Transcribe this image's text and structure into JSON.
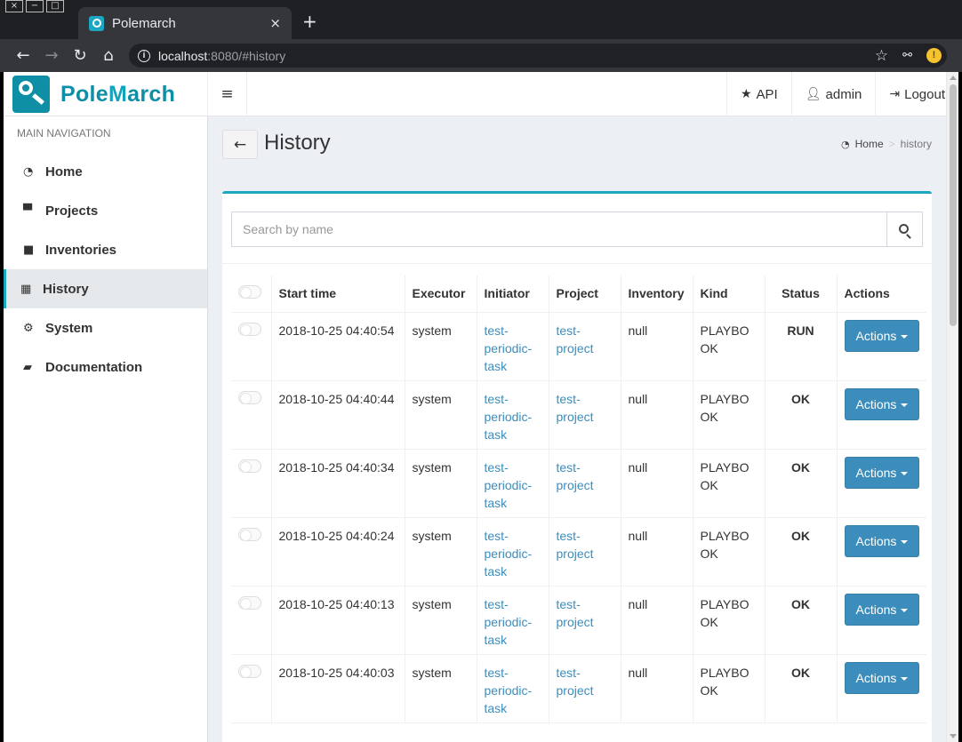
{
  "browser": {
    "tab_title": "Polemarch",
    "tab_close": "×",
    "new_tab": "+",
    "url_host": "localhost",
    "url_rest": ":8080/#history",
    "info_glyph": "i",
    "alert_glyph": "!"
  },
  "window_controls": [
    "×",
    "−",
    "□"
  ],
  "app": {
    "logo_part1": "Pole",
    "logo_part2": "M",
    "logo_part3": "arch",
    "menu_toggle": "≡",
    "top_links": {
      "api": "API",
      "user": "admin",
      "logout": "Logout"
    }
  },
  "sidebar": {
    "header": "MAIN NAVIGATION",
    "items": [
      {
        "label": "Home",
        "icon": "dashboard-icon",
        "glyph": "◔"
      },
      {
        "label": "Projects",
        "icon": "projects-icon",
        "glyph": "▀"
      },
      {
        "label": "Inventories",
        "icon": "folder-icon",
        "glyph": "■"
      },
      {
        "label": "History",
        "icon": "calendar-icon",
        "glyph": "▦",
        "active": true
      },
      {
        "label": "System",
        "icon": "gear-icon",
        "glyph": "⚙"
      },
      {
        "label": "Documentation",
        "icon": "book-icon",
        "glyph": "▰"
      }
    ]
  },
  "page": {
    "back_glyph": "🡐",
    "title": "History",
    "breadcrumb": {
      "home": "Home",
      "sep": ">",
      "current": "history"
    }
  },
  "search": {
    "placeholder": "Search by name"
  },
  "table": {
    "headers": [
      "Start time",
      "Executor",
      "Initiator",
      "Project",
      "Inventory",
      "Kind",
      "Status",
      "Actions"
    ],
    "action_label": "Actions",
    "rows": [
      {
        "start": "2018-10-25 04:40:54",
        "executor": "system",
        "initiator": "test-periodic-task",
        "project": "test-project",
        "inventory": "null",
        "kind": "PLAYBOOK",
        "status": "RUN"
      },
      {
        "start": "2018-10-25 04:40:44",
        "executor": "system",
        "initiator": "test-periodic-task",
        "project": "test-project",
        "inventory": "null",
        "kind": "PLAYBOOK",
        "status": "OK"
      },
      {
        "start": "2018-10-25 04:40:34",
        "executor": "system",
        "initiator": "test-periodic-task",
        "project": "test-project",
        "inventory": "null",
        "kind": "PLAYBOOK",
        "status": "OK"
      },
      {
        "start": "2018-10-25 04:40:24",
        "executor": "system",
        "initiator": "test-periodic-task",
        "project": "test-project",
        "inventory": "null",
        "kind": "PLAYBOOK",
        "status": "OK"
      },
      {
        "start": "2018-10-25 04:40:13",
        "executor": "system",
        "initiator": "test-periodic-task",
        "project": "test-project",
        "inventory": "null",
        "kind": "PLAYBOOK",
        "status": "OK"
      },
      {
        "start": "2018-10-25 04:40:03",
        "executor": "system",
        "initiator": "test-periodic-task",
        "project": "test-project",
        "inventory": "null",
        "kind": "PLAYBOOK",
        "status": "OK"
      }
    ]
  },
  "colors": {
    "accent": "#1ba6c2",
    "link": "#3c8dbc",
    "button": "#3c8dbc",
    "logo": "#0f8fa6"
  }
}
